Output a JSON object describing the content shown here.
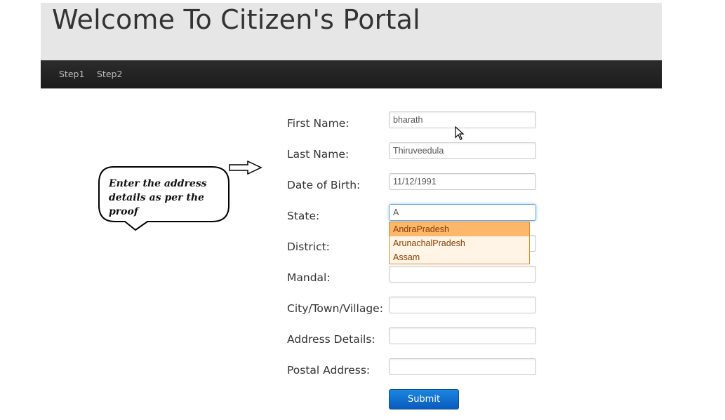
{
  "header": {
    "title": "Welcome To Citizen's Portal"
  },
  "nav": {
    "items": [
      {
        "label": "Step1"
      },
      {
        "label": "Step2"
      }
    ]
  },
  "callout": {
    "text": "Enter the address details as per the proof"
  },
  "form": {
    "fields": [
      {
        "label": "First Name:",
        "value": "bharath"
      },
      {
        "label": "Last Name:",
        "value": "Thiruveedula"
      },
      {
        "label": "Date of Birth:",
        "value": "11/12/1991"
      },
      {
        "label": "State:",
        "value": "A"
      },
      {
        "label": "District:",
        "value": ""
      },
      {
        "label": "Mandal:",
        "value": ""
      },
      {
        "label": "City/Town/Village:",
        "value": ""
      },
      {
        "label": "Address Details:",
        "value": ""
      },
      {
        "label": "Postal Address:",
        "value": ""
      }
    ],
    "autocomplete": [
      {
        "label": "AndraPradesh"
      },
      {
        "label": "ArunachalPradesh"
      },
      {
        "label": "Assam"
      }
    ],
    "submit_label": "Submit"
  },
  "colors": {
    "accent": "#0a5bbd",
    "navbar": "#1b1b1b",
    "highlight": "#fcb76b"
  }
}
